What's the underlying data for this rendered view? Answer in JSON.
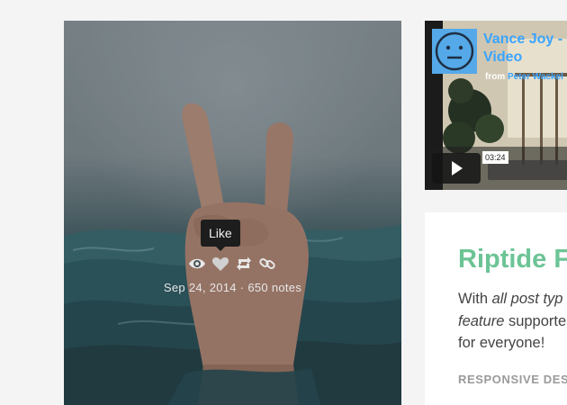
{
  "photo_post": {
    "tooltip": "Like",
    "date": "Sep 24, 2014",
    "separator": "·",
    "notes": "650 notes",
    "actions": [
      "eye-icon",
      "heart-icon",
      "reblog-icon",
      "link-icon"
    ]
  },
  "video_post": {
    "title_line1": "Vance Joy -",
    "title_line2": "Video",
    "from_label": "from",
    "author": "Peter Wackel",
    "timecode": "03:24"
  },
  "text_post": {
    "title": "Riptide F",
    "body_line1_pre": "With ",
    "body_line1_em": "all post typ",
    "body_line2_em": "feature",
    "body_line2_post": " supporte",
    "body_line3": "for everyone!",
    "tag": "RESPONSIVE DES"
  },
  "colors": {
    "page_bg": "#f4f4f4",
    "title_green": "#6cc495",
    "vimeo_blue": "#3aa4ff"
  }
}
